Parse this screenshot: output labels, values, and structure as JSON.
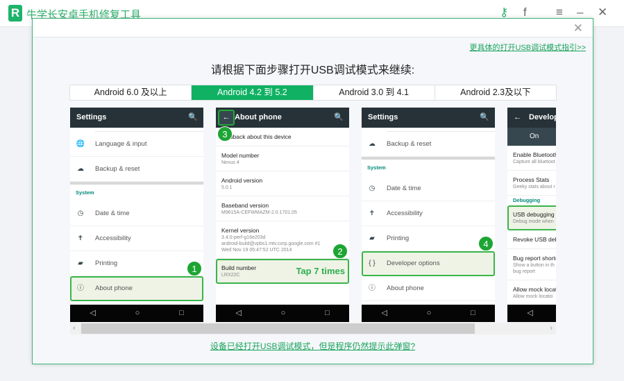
{
  "app": {
    "title": "牛学长安卓手机修复工具",
    "logo_letter": "R",
    "icons": [
      "key-icon",
      "facebook-icon",
      "menu-icon",
      "minimize-icon",
      "close-icon"
    ]
  },
  "dialog": {
    "guide_link": "更具体的打开USB调试模式指引>>",
    "heading": "请根据下面步骤打开USB调试模式来继续:",
    "tabs": [
      {
        "label": "Android 6.0 及以上",
        "active": false
      },
      {
        "label": "Android 4.2 到 5.2",
        "active": true
      },
      {
        "label": "Android 3.0 到 4.1",
        "active": false
      },
      {
        "label": "Android 2.3及以下",
        "active": false
      }
    ],
    "bottom_link": "设备已经打开USB调试模式，但是程序仍然提示此弹窗?",
    "accent": "#10b163"
  },
  "phones": [
    {
      "title": "Settings",
      "back": false,
      "rows": [
        {
          "kind": "spacer"
        },
        {
          "kind": "item",
          "icon": "🌐",
          "label": "Language & input"
        },
        {
          "kind": "item",
          "icon": "☁",
          "label": "Backup & reset"
        },
        {
          "kind": "gap"
        },
        {
          "kind": "label",
          "label": "System"
        },
        {
          "kind": "item",
          "icon": "◷",
          "label": "Date & time"
        },
        {
          "kind": "item",
          "icon": "✝",
          "label": "Accessibility"
        },
        {
          "kind": "item",
          "icon": "▰",
          "label": "Printing"
        },
        {
          "kind": "item",
          "icon": "ⓘ",
          "label": "About phone",
          "highlight": true,
          "badge": "1"
        }
      ]
    },
    {
      "title": "About phone",
      "back": true,
      "back_badge": "3",
      "rows": [
        {
          "kind": "detail",
          "label": "     feedback about this device",
          "sub": []
        },
        {
          "kind": "detail",
          "label": "Model number",
          "sub": [
            "Nexus 4"
          ]
        },
        {
          "kind": "detail",
          "label": "Android version",
          "sub": [
            "5.0.1"
          ]
        },
        {
          "kind": "detail",
          "label": "Baseband version",
          "sub": [
            "M9615A-CEFWMAZM-2.0.1701.05"
          ]
        },
        {
          "kind": "detail",
          "label": "Kernel version",
          "sub": [
            "3.4.0-perf-g16e203d",
            "android-build@vpbs1.mtv.corp.google.com #1",
            "Wed Nov 19 05:47:52 UTC 2014"
          ]
        },
        {
          "kind": "detail",
          "label": "Build number",
          "sub": [
            "LRX22C"
          ],
          "highlight": true,
          "badge": "2",
          "note": "Tap 7 times"
        }
      ]
    },
    {
      "title": "Settings",
      "back": false,
      "rows": [
        {
          "kind": "spacer"
        },
        {
          "kind": "item",
          "icon": "☁",
          "label": "Backup & reset"
        },
        {
          "kind": "gap"
        },
        {
          "kind": "label",
          "label": "System"
        },
        {
          "kind": "item",
          "icon": "◷",
          "label": "Date & time"
        },
        {
          "kind": "item",
          "icon": "✝",
          "label": "Accessibility"
        },
        {
          "kind": "item",
          "icon": "▰",
          "label": "Printing"
        },
        {
          "kind": "item",
          "icon": "{ }",
          "label": "Developer options",
          "highlight": true,
          "badge": "4"
        },
        {
          "kind": "item",
          "icon": "ⓘ",
          "label": "About phone"
        }
      ]
    },
    {
      "title": "Develop",
      "back": true,
      "on_label": "On",
      "rows": [
        {
          "kind": "detail",
          "label": "Enable Bluetooth",
          "sub": [
            "Capture all bluetoot"
          ]
        },
        {
          "kind": "detail",
          "label": "Process Stats",
          "sub": [
            "Geeky stats about r"
          ]
        },
        {
          "kind": "label",
          "label": "Debugging",
          "small": true
        },
        {
          "kind": "detail",
          "label": "USB debugging",
          "sub": [
            "Debug mode when"
          ],
          "highlight": true
        },
        {
          "kind": "detail",
          "label": "Revoke USB debu",
          "sub": []
        },
        {
          "kind": "detail",
          "label": "Bug report shortc",
          "sub": [
            "Show a button in th",
            "bug report"
          ]
        },
        {
          "kind": "detail",
          "label": "Allow mock locat",
          "sub": [
            "Allow mock locatio"
          ]
        }
      ]
    }
  ],
  "nav_icons": {
    "back": "◁",
    "home": "○",
    "recent": "□",
    "search": "🔍",
    "arrow": "←"
  },
  "scrollbar": {
    "left_arrow": "‹",
    "right_arrow": "›",
    "position_percent": 0
  }
}
